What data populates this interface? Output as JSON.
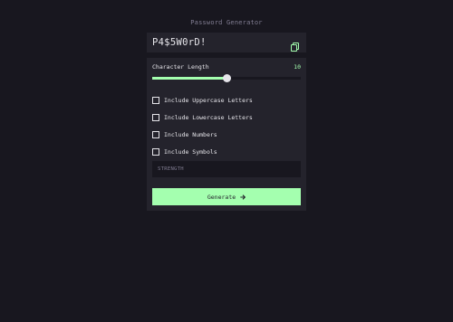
{
  "app": {
    "title": "Password Generator"
  },
  "output": {
    "password": "P4$5W0rD!",
    "copy_icon": "copy-icon"
  },
  "length": {
    "label": "Character Length",
    "value": "10",
    "slider_fraction": 0.5
  },
  "options": [
    {
      "label": "Include Uppercase Letters",
      "checked": false
    },
    {
      "label": "Include Lowercase Letters",
      "checked": false
    },
    {
      "label": "Include Numbers",
      "checked": false
    },
    {
      "label": "Include Symbols",
      "checked": false
    }
  ],
  "strength": {
    "label": "STRENGTH"
  },
  "generate": {
    "label": "Generate",
    "icon": "arrow-right-icon"
  },
  "colors": {
    "background": "#18171f",
    "panel": "#24232c",
    "accent": "#a4ffaf",
    "text": "#e6e5ea",
    "muted": "#817d92"
  }
}
